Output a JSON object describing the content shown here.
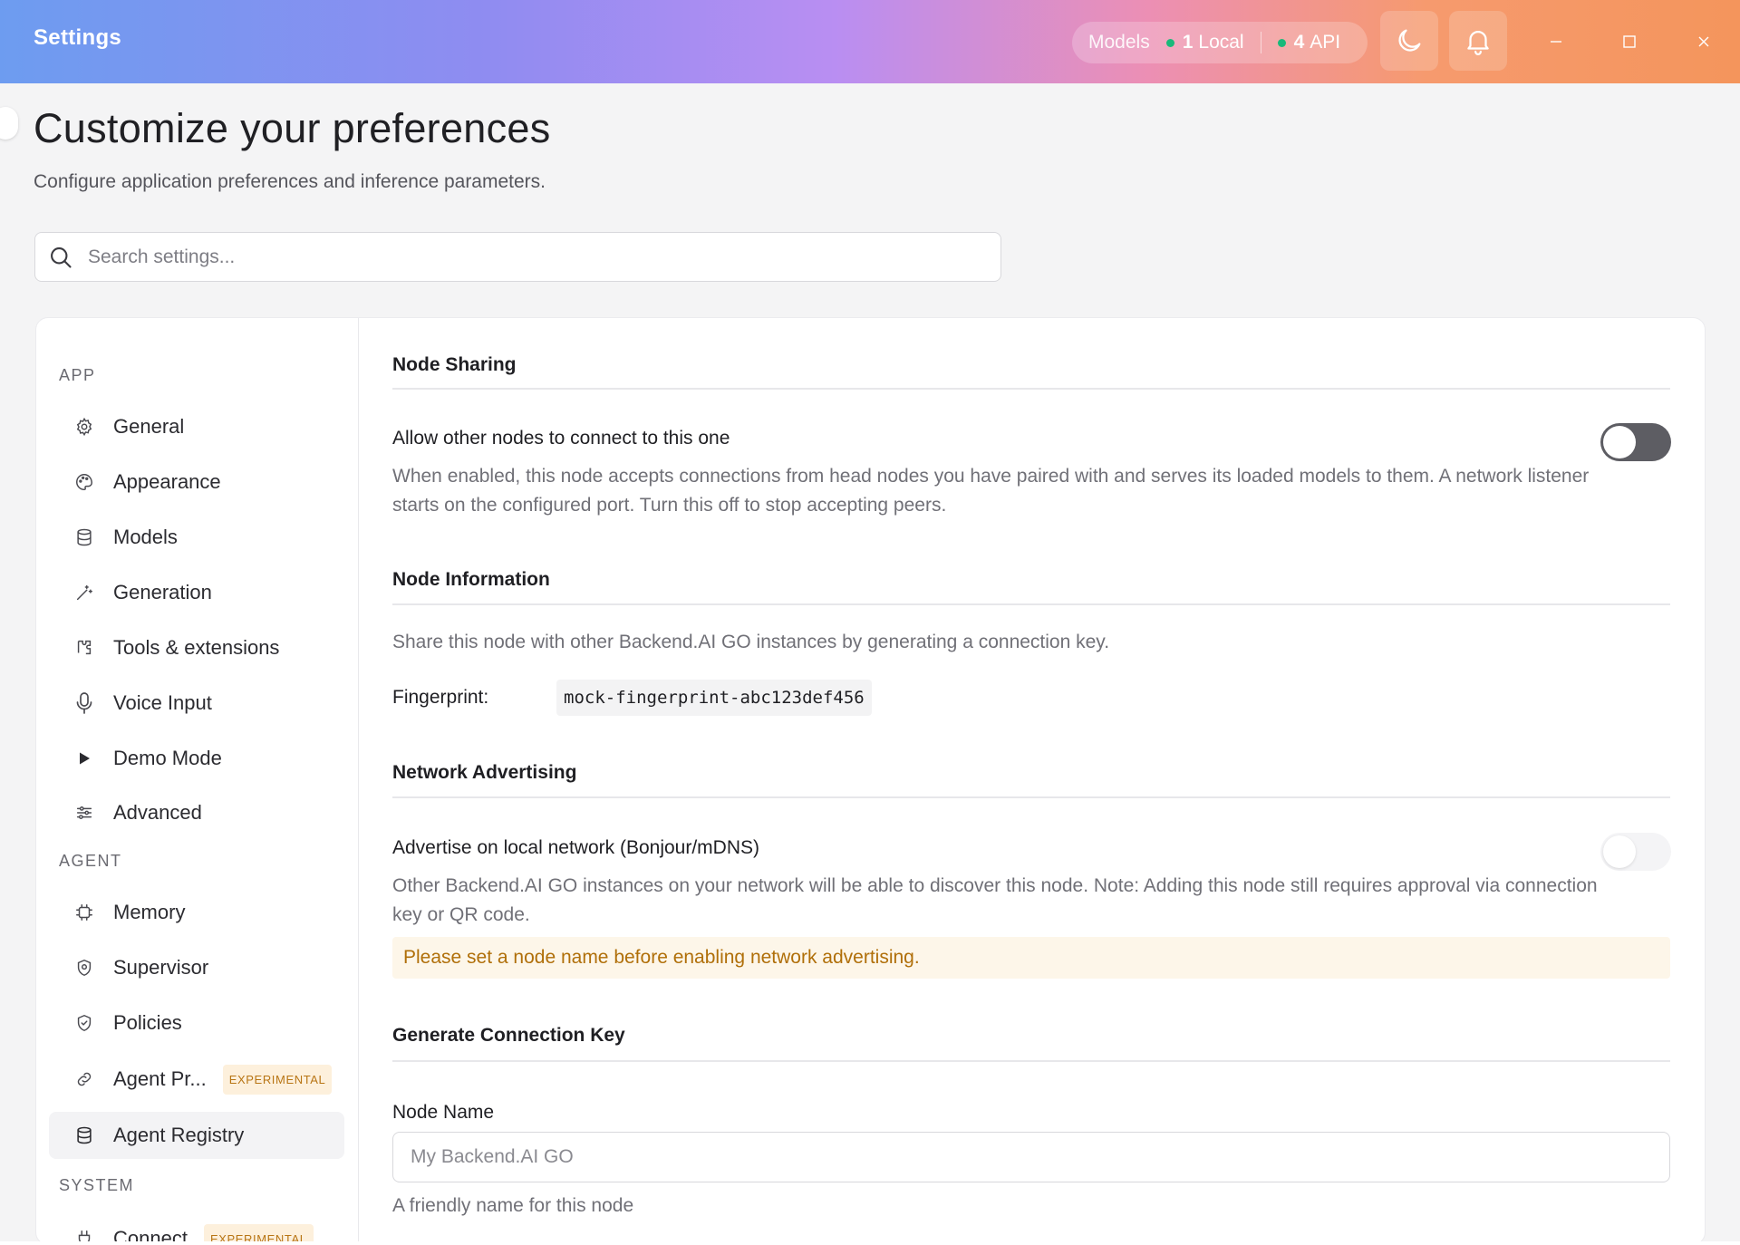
{
  "titlebar": {
    "title": "Settings",
    "models_label": "Models",
    "local_count": "1",
    "local_label": "Local",
    "api_count": "4",
    "api_label": "API",
    "status_color": "#19b97a"
  },
  "header": {
    "title": "Customize your preferences",
    "subtitle": "Configure application preferences and inference parameters.",
    "search_placeholder": "Search settings..."
  },
  "sidebar": {
    "groups": [
      {
        "label": "APP",
        "items": [
          {
            "label": "General",
            "icon": "gear-icon"
          },
          {
            "label": "Appearance",
            "icon": "palette-icon"
          },
          {
            "label": "Models",
            "icon": "database-icon"
          },
          {
            "label": "Generation",
            "icon": "wand-icon"
          },
          {
            "label": "Tools & extensions",
            "icon": "puzzle-icon"
          },
          {
            "label": "Voice Input",
            "icon": "microphone-icon"
          },
          {
            "label": "Demo Mode",
            "icon": "play-icon"
          },
          {
            "label": "Advanced",
            "icon": "sliders-icon"
          }
        ]
      },
      {
        "label": "AGENT",
        "items": [
          {
            "label": "Memory",
            "icon": "chip-icon"
          },
          {
            "label": "Supervisor",
            "icon": "shield-icon"
          },
          {
            "label": "Policies",
            "icon": "shield-check-icon"
          },
          {
            "label": "Agent Pr...",
            "icon": "link-icon",
            "badge": "EXPERIMENTAL"
          },
          {
            "label": "Agent Registry",
            "icon": "database-icon",
            "active": true
          }
        ]
      },
      {
        "label": "SYSTEM",
        "items": [
          {
            "label": "Connect",
            "icon": "plug-icon",
            "badge": "EXPERIMENTAL"
          }
        ]
      }
    ]
  },
  "content": {
    "node_sharing": {
      "title": "Node Sharing",
      "allow_title": "Allow other nodes to connect to this one",
      "allow_desc": "When enabled, this node accepts connections from head nodes you have paired with and serves its loaded models to them. A network listener starts on the configured port. Turn this off to stop accepting peers.",
      "allow_enabled": false
    },
    "node_information": {
      "title": "Node Information",
      "desc": "Share this node with other Backend.AI GO instances by generating a connection key.",
      "fingerprint_label": "Fingerprint:",
      "fingerprint_value": "mock-fingerprint-abc123def456"
    },
    "network_advertising": {
      "title": "Network Advertising",
      "advertise_title": "Advertise on local network (Bonjour/mDNS)",
      "advertise_desc": "Other Backend.AI GO instances on your network will be able to discover this node. Note: Adding this node still requires approval via connection key or QR code.",
      "advertise_enabled": false,
      "warning": "Please set a node name before enabling network advertising."
    },
    "connection_key": {
      "title": "Generate Connection Key",
      "node_name_label": "Node Name",
      "node_name_value": "",
      "node_name_placeholder": "My Backend.AI GO",
      "node_name_hint": "A friendly name for this node"
    }
  }
}
